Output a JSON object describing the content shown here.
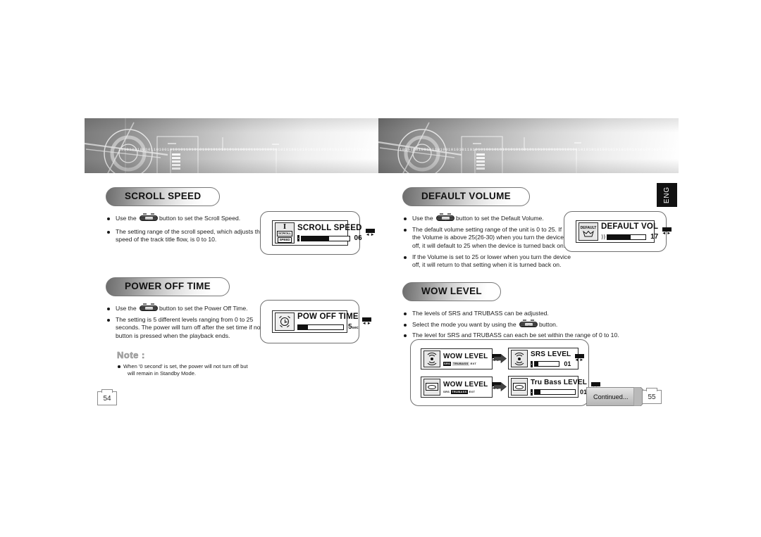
{
  "document": {
    "language_tab": "ENG",
    "continued_label": "Continued...",
    "page_left_number": "54",
    "page_right_number": "55",
    "banner_binary": "10101001001011010010101011010101001010101010100101101010010101010010101010100101010100101010010101011010010101101010010101010"
  },
  "left_page": {
    "sections": [
      {
        "title": "SCROLL SPEED",
        "bullets": [
          {
            "pre": "Use the ",
            "icon": "rocker-button-icon",
            "post": "button to set the Scroll Speed."
          },
          {
            "pre": "The setting range of the scroll speed, which adjusts the speed of the track title flow, is  0 to 10."
          }
        ],
        "lcd": {
          "icon_top": "I",
          "icon_line1": "SCROLL",
          "icon_line2": "SPEED",
          "title": "SCROLL SPEED",
          "value": "06",
          "meter_percent": 58,
          "nav": "left-right-arrows-icon"
        }
      },
      {
        "title": "POWER OFF TIME",
        "bullets": [
          {
            "pre": "Use the ",
            "icon": "rocker-button-icon",
            "post": "button to set the Power Off Time."
          },
          {
            "pre": "The setting is 5 different levels ranging from 0 to 25 seconds. The power will turn off after the set time if no button is pressed when the playback ends."
          }
        ],
        "lcd": {
          "icon": "alarm-clock-icon",
          "title": "POW OFF TIME",
          "value": "5",
          "unit": "sec",
          "meter_percent": 22,
          "nav": "left-right-arrows-icon"
        }
      }
    ],
    "note": {
      "heading": "Note :",
      "line1": "When '0 second' is set, the power will not turn off but",
      "line2": "will remain in Standby Mode."
    }
  },
  "right_page": {
    "sections": [
      {
        "title": "DEFAULT VOLUME",
        "bullets": [
          {
            "pre": "Use the ",
            "icon": "rocker-button-icon",
            "post": "button to set the Default Volume."
          },
          {
            "pre": "The default volume setting range of the unit is 0 to 25. If the Volume is above 25(26-30) when you turn the device off, it will default to 25 when the device is turned back on."
          },
          {
            "pre": "If the Volume is set to 25 or lower when you turn the device off, it will return to that setting when it is turned back on."
          }
        ],
        "lcd": {
          "icon_top": "DEFAULT",
          "icon_glyph": "crown-icon",
          "title": "DEFAULT  VOL",
          "value": "17",
          "meter_percent": 60,
          "speaker": "speaker-icon",
          "nav": "left-right-arrows-icon"
        }
      },
      {
        "title": "WOW LEVEL",
        "bullets": [
          {
            "pre": "The levels of SRS and TRUBASS can be adjusted."
          },
          {
            "pre": "Select the mode you want by using the ",
            "icon": "rocker-button-icon",
            "post": "button."
          },
          {
            "pre": "The level for SRS and TRUBASS can each be set within the range of 0 to 10."
          }
        ],
        "flow": [
          {
            "from": {
              "icon": "srs-waves-icon",
              "title": "WOW LEVEL",
              "sub": [
                "SRS",
                "TRUBASS",
                "EXT"
              ],
              "sub_highlight": "SRS",
              "nav": "left-right-arrows-icon"
            },
            "arrow": "arrow-right-icon",
            "to": {
              "icon": "srs-waves-icon",
              "title": "SRS LEVEL",
              "value": "01",
              "meter_percent": 14,
              "nav": "left-right-arrows-icon"
            }
          },
          {
            "from": {
              "icon": "trubass-speaker-icon",
              "title": "WOW LEVEL",
              "sub": [
                "SRS",
                "TRUBASS",
                "EXT"
              ],
              "sub_highlight": "TRUBASS",
              "nav": "left-right-arrows-icon"
            },
            "arrow": "arrow-right-icon",
            "to": {
              "icon": "trubass-speaker-icon",
              "title": "Tru Bass LEVEL",
              "value": "01",
              "meter_percent": 14,
              "nav": "left-right-arrows-icon"
            }
          }
        ]
      }
    ]
  }
}
